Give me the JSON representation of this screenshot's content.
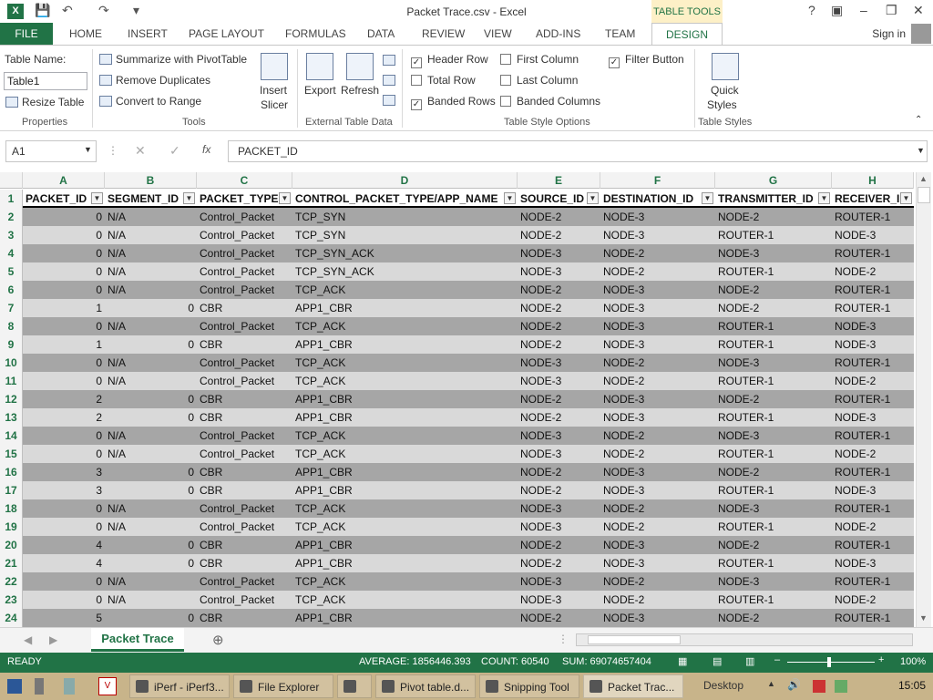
{
  "window": {
    "title": "Packet Trace.csv - Excel",
    "tool_context": "TABLE TOOLS",
    "help": "?"
  },
  "ribbon_tabs": [
    "FILE",
    "HOME",
    "INSERT",
    "PAGE LAYOUT",
    "FORMULAS",
    "DATA",
    "REVIEW",
    "VIEW",
    "ADD-INS",
    "TEAM",
    "DESIGN"
  ],
  "sign_in": "Sign in",
  "ribbon": {
    "table_name_label": "Table Name:",
    "table_name_value": "Table1",
    "resize_table": "Resize Table",
    "properties": "Properties",
    "summarize": "Summarize with PivotTable",
    "remove_duplicates": "Remove Duplicates",
    "convert_to_range": "Convert to Range",
    "tools": "Tools",
    "insert_slicer": "Insert",
    "insert_slicer2": "Slicer",
    "export": "Export",
    "refresh": "Refresh",
    "external_table_data": "External Table Data",
    "header_row": "Header Row",
    "total_row": "Total Row",
    "banded_rows": "Banded Rows",
    "first_column": "First Column",
    "last_column": "Last Column",
    "banded_columns": "Banded Columns",
    "filter_button": "Filter Button",
    "table_style_options": "Table Style Options",
    "quick_styles": "Quick",
    "quick_styles2": "Styles",
    "table_styles": "Table Styles"
  },
  "name_box": "A1",
  "fx": "fx",
  "formula_value": "PACKET_ID",
  "column_letters": [
    "A",
    "B",
    "C",
    "D",
    "E",
    "F",
    "G",
    "H"
  ],
  "headers": [
    "PACKET_ID",
    "SEGMENT_ID",
    "PACKET_TYPE",
    "CONTROL_PACKET_TYPE/APP_NAME",
    "SOURCE_ID",
    "DESTINATION_ID",
    "TRANSMITTER_ID",
    "RECEIVER_ID"
  ],
  "rows": [
    [
      "2",
      "0",
      "N/A",
      "Control_Packet",
      "TCP_SYN",
      "NODE-2",
      "NODE-3",
      "NODE-2",
      "ROUTER-1"
    ],
    [
      "3",
      "0",
      "N/A",
      "Control_Packet",
      "TCP_SYN",
      "NODE-2",
      "NODE-3",
      "ROUTER-1",
      "NODE-3"
    ],
    [
      "4",
      "0",
      "N/A",
      "Control_Packet",
      "TCP_SYN_ACK",
      "NODE-3",
      "NODE-2",
      "NODE-3",
      "ROUTER-1"
    ],
    [
      "5",
      "0",
      "N/A",
      "Control_Packet",
      "TCP_SYN_ACK",
      "NODE-3",
      "NODE-2",
      "ROUTER-1",
      "NODE-2"
    ],
    [
      "6",
      "0",
      "N/A",
      "Control_Packet",
      "TCP_ACK",
      "NODE-2",
      "NODE-3",
      "NODE-2",
      "ROUTER-1"
    ],
    [
      "7",
      "1",
      "0",
      "CBR",
      "APP1_CBR",
      "NODE-2",
      "NODE-3",
      "NODE-2",
      "ROUTER-1"
    ],
    [
      "8",
      "0",
      "N/A",
      "Control_Packet",
      "TCP_ACK",
      "NODE-2",
      "NODE-3",
      "ROUTER-1",
      "NODE-3"
    ],
    [
      "9",
      "1",
      "0",
      "CBR",
      "APP1_CBR",
      "NODE-2",
      "NODE-3",
      "ROUTER-1",
      "NODE-3"
    ],
    [
      "10",
      "0",
      "N/A",
      "Control_Packet",
      "TCP_ACK",
      "NODE-3",
      "NODE-2",
      "NODE-3",
      "ROUTER-1"
    ],
    [
      "11",
      "0",
      "N/A",
      "Control_Packet",
      "TCP_ACK",
      "NODE-3",
      "NODE-2",
      "ROUTER-1",
      "NODE-2"
    ],
    [
      "12",
      "2",
      "0",
      "CBR",
      "APP1_CBR",
      "NODE-2",
      "NODE-3",
      "NODE-2",
      "ROUTER-1"
    ],
    [
      "13",
      "2",
      "0",
      "CBR",
      "APP1_CBR",
      "NODE-2",
      "NODE-3",
      "ROUTER-1",
      "NODE-3"
    ],
    [
      "14",
      "0",
      "N/A",
      "Control_Packet",
      "TCP_ACK",
      "NODE-3",
      "NODE-2",
      "NODE-3",
      "ROUTER-1"
    ],
    [
      "15",
      "0",
      "N/A",
      "Control_Packet",
      "TCP_ACK",
      "NODE-3",
      "NODE-2",
      "ROUTER-1",
      "NODE-2"
    ],
    [
      "16",
      "3",
      "0",
      "CBR",
      "APP1_CBR",
      "NODE-2",
      "NODE-3",
      "NODE-2",
      "ROUTER-1"
    ],
    [
      "17",
      "3",
      "0",
      "CBR",
      "APP1_CBR",
      "NODE-2",
      "NODE-3",
      "ROUTER-1",
      "NODE-3"
    ],
    [
      "18",
      "0",
      "N/A",
      "Control_Packet",
      "TCP_ACK",
      "NODE-3",
      "NODE-2",
      "NODE-3",
      "ROUTER-1"
    ],
    [
      "19",
      "0",
      "N/A",
      "Control_Packet",
      "TCP_ACK",
      "NODE-3",
      "NODE-2",
      "ROUTER-1",
      "NODE-2"
    ],
    [
      "20",
      "4",
      "0",
      "CBR",
      "APP1_CBR",
      "NODE-2",
      "NODE-3",
      "NODE-2",
      "ROUTER-1"
    ],
    [
      "21",
      "4",
      "0",
      "CBR",
      "APP1_CBR",
      "NODE-2",
      "NODE-3",
      "ROUTER-1",
      "NODE-3"
    ],
    [
      "22",
      "0",
      "N/A",
      "Control_Packet",
      "TCP_ACK",
      "NODE-3",
      "NODE-2",
      "NODE-3",
      "ROUTER-1"
    ],
    [
      "23",
      "0",
      "N/A",
      "Control_Packet",
      "TCP_ACK",
      "NODE-3",
      "NODE-2",
      "ROUTER-1",
      "NODE-2"
    ],
    [
      "24",
      "5",
      "0",
      "CBR",
      "APP1_CBR",
      "NODE-2",
      "NODE-3",
      "NODE-2",
      "ROUTER-1"
    ]
  ],
  "sheet_tab": "Packet Trace",
  "status": {
    "ready": "READY",
    "average": "AVERAGE: 1856446.393",
    "count": "COUNT: 60540",
    "sum": "SUM: 69074657404",
    "zoom": "100%"
  },
  "taskbar": {
    "items": [
      "iPerf - iPerf3...",
      "File Explorer",
      "",
      "Pivot table.d...",
      "Snipping Tool",
      "Packet Trac..."
    ],
    "desktop": "Desktop",
    "clock": "15:05"
  },
  "colors": {
    "excel_green": "#217346",
    "band_dark": "#a6a6a6",
    "band_light": "#d9d9d9"
  }
}
